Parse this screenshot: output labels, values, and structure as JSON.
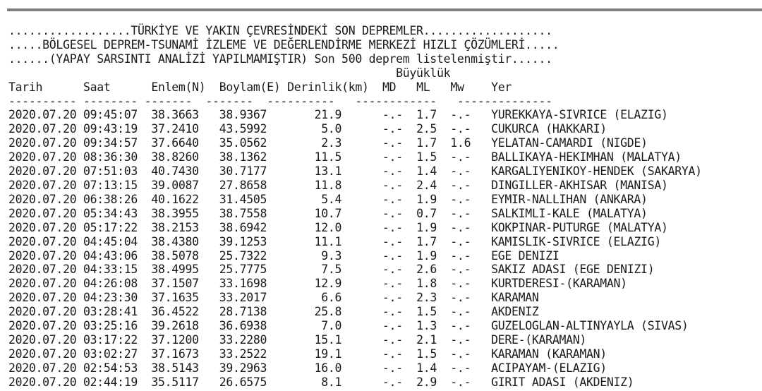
{
  "header_lines": [
    "..................TÜRKİYE VE YAKIN ÇEVRESİNDEKİ SON DEPREMLER...................",
    ".....BÖLGESEL DEPREM-TSUNAMİ İZLEME VE DEĞERLENDİRME MERKEZİ HIZLI ÇÖZÜMLERİ.....",
    "......(YAPAY SARSINTI ANALİZİ YAPILMAMIŞTIR) Son 500 deprem listelenmiştir......"
  ],
  "magnitude_group_label": "Büyüklük",
  "columns": {
    "tarih": "Tarih",
    "saat": "Saat",
    "enlem": "Enlem(N)",
    "boylam": "Boylam(E)",
    "derinlik": "Derinlik(km)",
    "md": "MD",
    "ml": "ML",
    "mw": "Mw",
    "yer": "Yer"
  },
  "dash_line": "---------- -------- -------  -------  ----------   ------------   --------------",
  "rows": [
    {
      "tarih": "2020.07.20",
      "saat": "09:45:07",
      "enlem": "38.3663",
      "boylam": "38.9367",
      "derinlik": "21.9",
      "md": "-.-",
      "ml": "1.7",
      "mw": "-.-",
      "yer": "YUREKKAYA-SIVRICE (ELAZIG)"
    },
    {
      "tarih": "2020.07.20",
      "saat": "09:43:19",
      "enlem": "37.2410",
      "boylam": "43.5992",
      "derinlik": "5.0",
      "md": "-.-",
      "ml": "2.5",
      "mw": "-.-",
      "yer": "CUKURCA (HAKKARI)"
    },
    {
      "tarih": "2020.07.20",
      "saat": "09:34:57",
      "enlem": "37.6640",
      "boylam": "35.0562",
      "derinlik": "2.3",
      "md": "-.-",
      "ml": "1.7",
      "mw": "1.6",
      "yer": "YELATAN-CAMARDI (NIGDE)"
    },
    {
      "tarih": "2020.07.20",
      "saat": "08:36:30",
      "enlem": "38.8260",
      "boylam": "38.1362",
      "derinlik": "11.5",
      "md": "-.-",
      "ml": "1.5",
      "mw": "-.-",
      "yer": "BALLIKAYA-HEKIMHAN (MALATYA)"
    },
    {
      "tarih": "2020.07.20",
      "saat": "07:51:03",
      "enlem": "40.7430",
      "boylam": "30.7177",
      "derinlik": "13.1",
      "md": "-.-",
      "ml": "1.4",
      "mw": "-.-",
      "yer": "KARGALIYENIKOY-HENDEK (SAKARYA)"
    },
    {
      "tarih": "2020.07.20",
      "saat": "07:13:15",
      "enlem": "39.0087",
      "boylam": "27.8658",
      "derinlik": "11.8",
      "md": "-.-",
      "ml": "2.4",
      "mw": "-.-",
      "yer": "DINGILLER-AKHISAR (MANISA)"
    },
    {
      "tarih": "2020.07.20",
      "saat": "06:38:26",
      "enlem": "40.1622",
      "boylam": "31.4505",
      "derinlik": "5.4",
      "md": "-.-",
      "ml": "1.9",
      "mw": "-.-",
      "yer": "EYMIR-NALLIHAN (ANKARA)"
    },
    {
      "tarih": "2020.07.20",
      "saat": "05:34:43",
      "enlem": "38.3955",
      "boylam": "38.7558",
      "derinlik": "10.7",
      "md": "-.-",
      "ml": "0.7",
      "mw": "-.-",
      "yer": "SALKIMLI-KALE (MALATYA)"
    },
    {
      "tarih": "2020.07.20",
      "saat": "05:17:22",
      "enlem": "38.2153",
      "boylam": "38.6942",
      "derinlik": "12.0",
      "md": "-.-",
      "ml": "1.9",
      "mw": "-.-",
      "yer": "KOKPINAR-PUTURGE (MALATYA)"
    },
    {
      "tarih": "2020.07.20",
      "saat": "04:45:04",
      "enlem": "38.4380",
      "boylam": "39.1253",
      "derinlik": "11.1",
      "md": "-.-",
      "ml": "1.7",
      "mw": "-.-",
      "yer": "KAMISLIK-SIVRICE (ELAZIG)"
    },
    {
      "tarih": "2020.07.20",
      "saat": "04:43:06",
      "enlem": "38.5078",
      "boylam": "25.7322",
      "derinlik": "9.3",
      "md": "-.-",
      "ml": "1.9",
      "mw": "-.-",
      "yer": "EGE DENIZI"
    },
    {
      "tarih": "2020.07.20",
      "saat": "04:33:15",
      "enlem": "38.4995",
      "boylam": "25.7775",
      "derinlik": "7.5",
      "md": "-.-",
      "ml": "2.6",
      "mw": "-.-",
      "yer": "SAKIZ ADASI (EGE DENIZI)"
    },
    {
      "tarih": "2020.07.20",
      "saat": "04:26:08",
      "enlem": "37.1507",
      "boylam": "33.1698",
      "derinlik": "12.9",
      "md": "-.-",
      "ml": "1.8",
      "mw": "-.-",
      "yer": "KURTDERESI-(KARAMAN)"
    },
    {
      "tarih": "2020.07.20",
      "saat": "04:23:30",
      "enlem": "37.1635",
      "boylam": "33.2017",
      "derinlik": "6.6",
      "md": "-.-",
      "ml": "2.3",
      "mw": "-.-",
      "yer": "KARAMAN"
    },
    {
      "tarih": "2020.07.20",
      "saat": "03:28:41",
      "enlem": "36.4522",
      "boylam": "28.7138",
      "derinlik": "25.8",
      "md": "-.-",
      "ml": "1.5",
      "mw": "-.-",
      "yer": "AKDENIZ"
    },
    {
      "tarih": "2020.07.20",
      "saat": "03:25:16",
      "enlem": "39.2618",
      "boylam": "36.6938",
      "derinlik": "7.0",
      "md": "-.-",
      "ml": "1.3",
      "mw": "-.-",
      "yer": "GUZELOGLAN-ALTINYAYLA (SIVAS)"
    },
    {
      "tarih": "2020.07.20",
      "saat": "03:17:22",
      "enlem": "37.1200",
      "boylam": "33.2280",
      "derinlik": "15.1",
      "md": "-.-",
      "ml": "2.1",
      "mw": "-.-",
      "yer": "DERE-(KARAMAN)"
    },
    {
      "tarih": "2020.07.20",
      "saat": "03:02:27",
      "enlem": "37.1673",
      "boylam": "33.2522",
      "derinlik": "19.1",
      "md": "-.-",
      "ml": "1.5",
      "mw": "-.-",
      "yer": "KARAMAN (KARAMAN)"
    },
    {
      "tarih": "2020.07.20",
      "saat": "02:54:53",
      "enlem": "38.5143",
      "boylam": "39.2963",
      "derinlik": "16.0",
      "md": "-.-",
      "ml": "1.4",
      "mw": "-.-",
      "yer": "ACIPAYAM-(ELAZIG)"
    },
    {
      "tarih": "2020.07.20",
      "saat": "02:44:19",
      "enlem": "35.5117",
      "boylam": "26.6575",
      "derinlik": "8.1",
      "md": "-.-",
      "ml": "2.9",
      "mw": "-.-",
      "yer": "GIRIT ADASI (AKDENIZ)"
    }
  ]
}
